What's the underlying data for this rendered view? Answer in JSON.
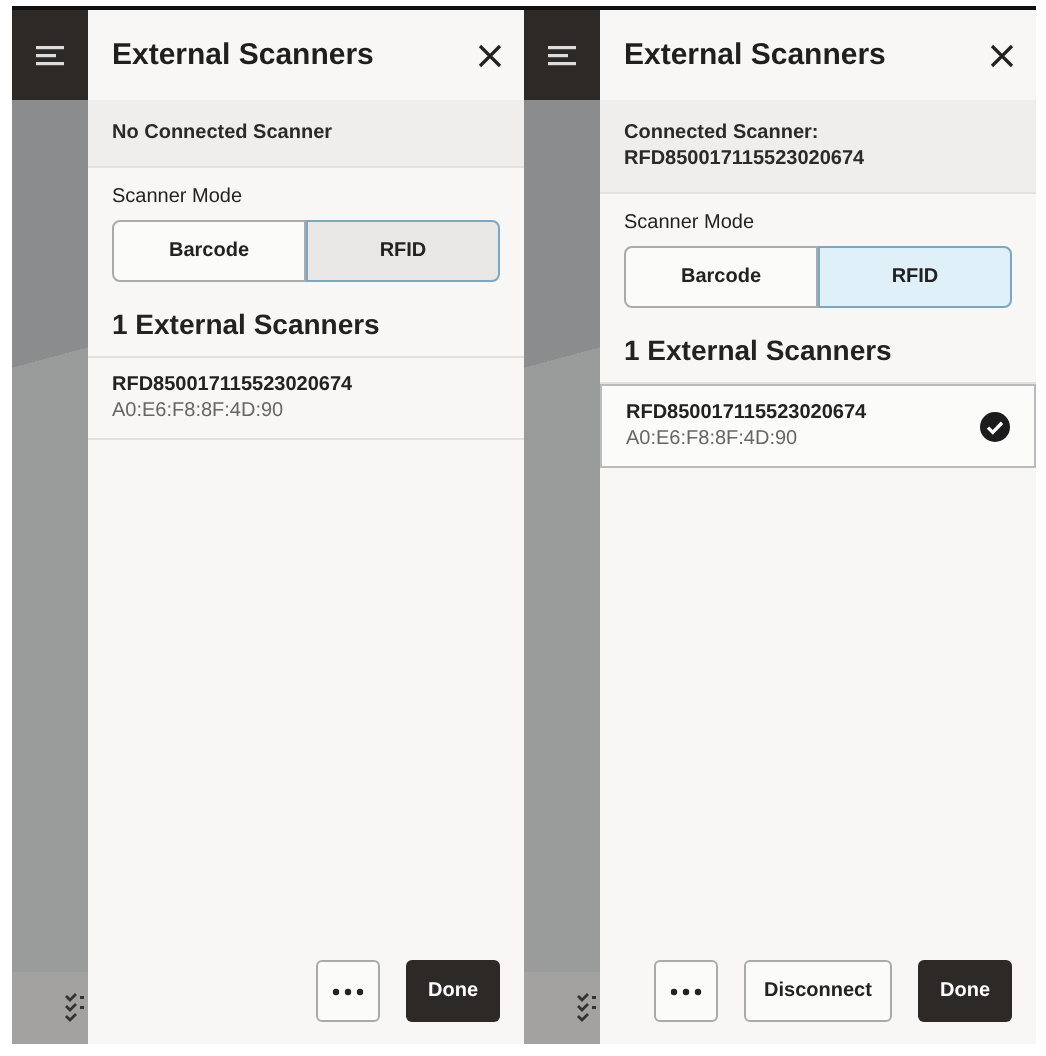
{
  "screens": [
    {
      "title": "External Scanners",
      "status_lines": [
        "No Connected Scanner"
      ],
      "mode_label": "Scanner Mode",
      "modes": [
        {
          "label": "Barcode",
          "selected": false,
          "focused": false
        },
        {
          "label": "RFID",
          "selected": true,
          "focused": false
        }
      ],
      "list_heading": "1 External Scanners",
      "scanners": [
        {
          "name": "RFD850017115523020674",
          "mac": "A0:E6:F8:8F:4D:90",
          "selected": false
        }
      ],
      "buttons": [
        {
          "kind": "more"
        },
        {
          "kind": "primary",
          "label": "Done"
        }
      ]
    },
    {
      "title": "External Scanners",
      "status_lines": [
        "Connected Scanner:",
        "RFD850017115523020674"
      ],
      "mode_label": "Scanner Mode",
      "modes": [
        {
          "label": "Barcode",
          "selected": false,
          "focused": false
        },
        {
          "label": "RFID",
          "selected": true,
          "focused": true
        }
      ],
      "list_heading": "1 External Scanners",
      "scanners": [
        {
          "name": "RFD850017115523020674",
          "mac": "A0:E6:F8:8F:4D:90",
          "selected": true
        }
      ],
      "buttons": [
        {
          "kind": "more"
        },
        {
          "kind": "secondary",
          "label": "Disconnect"
        },
        {
          "kind": "primary",
          "label": "Done"
        }
      ]
    }
  ]
}
